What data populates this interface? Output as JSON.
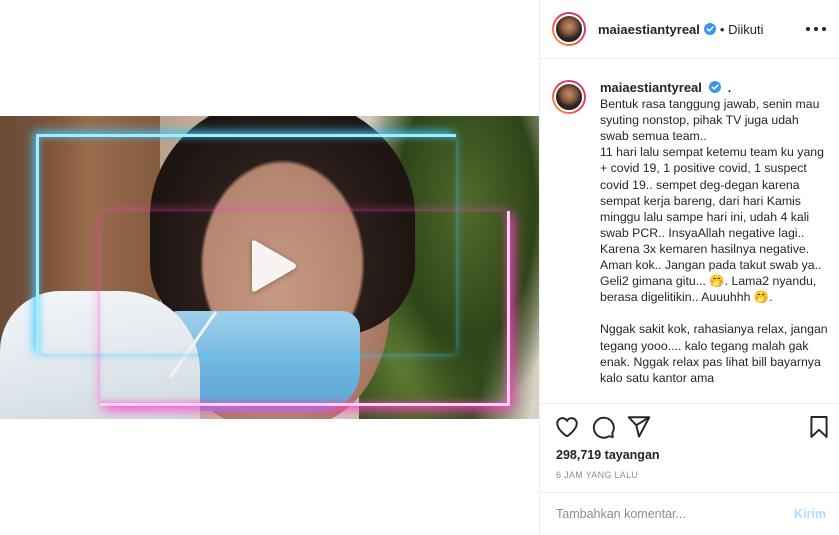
{
  "post": {
    "username": "maiaestiantyreal",
    "follow_status": "• Diikuti",
    "caption_dot": ".",
    "caption": "Bentuk rasa tanggung jawab, senin mau syuting nonstop, pihak TV juga udah swab semua team..\n11 hari lalu sempat ketemu team ku yang + covid 19, 1 positive covid, 1 suspect covid 19.. sempet deg-degan karena sempat kerja bareng, dari hari Kamis minggu lalu sampe hari ini, udah 4 kali swab PCR.. InsyaAllah negative lagi.. Karena 3x kemaren hasilnya negative. Aman kok.. Jangan pada takut swab ya.. Geli2 gimana gitu... 🤭. Lama2 nyandu, berasa digelitikin.. Auuuhhh 🤭.\n\nNggak sakit kok, rahasianya relax, jangan tegang yooo.... kalo tegang malah gak enak. Nggak relax pas lihat bill bayarnya kalo satu kantor ama",
    "views": "298,719 tayangan",
    "timestamp": "6 JAM YANG LALU"
  },
  "comment": {
    "placeholder": "Tambahkan komentar...",
    "send_label": "Kirim"
  },
  "colors": {
    "verified_badge": "#3897f0",
    "send_disabled": "#b3dbff",
    "muted_text": "#8e8e8e",
    "border": "#efefef"
  },
  "icons": {
    "video": "play-icon",
    "verified": "verified-badge-icon",
    "more": "more-options-icon",
    "like": "heart-icon",
    "comment": "comment-bubble-icon",
    "share": "paper-plane-icon",
    "save": "bookmark-icon"
  }
}
